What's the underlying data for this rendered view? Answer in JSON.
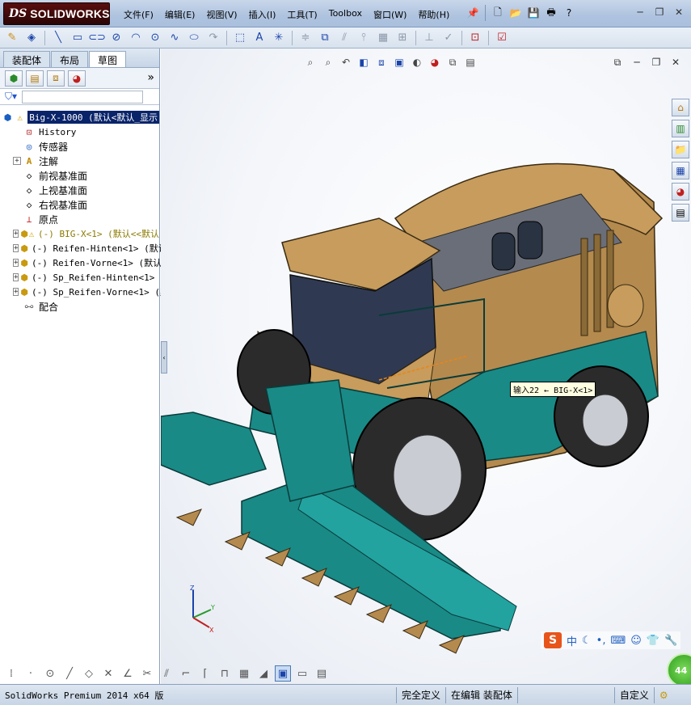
{
  "app": {
    "brand_prefix": "DS",
    "brand": "SOLIDWORKS"
  },
  "menu": [
    {
      "label": "文件(F)"
    },
    {
      "label": "编辑(E)"
    },
    {
      "label": "视图(V)"
    },
    {
      "label": "插入(I)"
    },
    {
      "label": "工具(T)"
    },
    {
      "label": "Toolbox"
    },
    {
      "label": "窗口(W)"
    },
    {
      "label": "帮助(H)"
    }
  ],
  "panel_tabs": [
    {
      "label": "装配体",
      "active": false
    },
    {
      "label": "布局",
      "active": false
    },
    {
      "label": "草图",
      "active": true
    }
  ],
  "tree": {
    "root": {
      "label": "Big-X-1000  (默认<默认_显示"
    },
    "items": [
      {
        "label": "History",
        "icon": "history-icon",
        "expandable": false
      },
      {
        "label": "传感器",
        "icon": "sensor-icon",
        "expandable": false
      },
      {
        "label": "注解",
        "icon": "annotation-icon",
        "expandable": true
      },
      {
        "label": "前视基准面",
        "icon": "plane-icon",
        "expandable": false
      },
      {
        "label": "上视基准面",
        "icon": "plane-icon",
        "expandable": false
      },
      {
        "label": "右视基准面",
        "icon": "plane-icon",
        "expandable": false
      },
      {
        "label": "原点",
        "icon": "origin-icon",
        "expandable": false
      },
      {
        "label": "(-) BIG-X<1> (默认<<默认",
        "icon": "part-warning-icon",
        "expandable": true,
        "warning": true
      },
      {
        "label": "(-) Reifen-Hinten<1> (默认",
        "icon": "subassembly-icon",
        "expandable": true
      },
      {
        "label": "(-) Reifen-Vorne<1> (默认<",
        "icon": "subassembly-icon",
        "expandable": true
      },
      {
        "label": "(-) Sp_Reifen-Hinten<1> (",
        "icon": "subassembly-icon",
        "expandable": true
      },
      {
        "label": "(-) Sp_Reifen-Vorne<1> (默",
        "icon": "subassembly-icon",
        "expandable": true
      },
      {
        "label": "配合",
        "icon": "mates-icon",
        "expandable": false
      }
    ]
  },
  "viewport": {
    "tooltip": "输入22 ← BIG-X<1>",
    "ime": {
      "label": "中"
    },
    "badge": "44"
  },
  "status": {
    "left": "SolidWorks Premium 2014 x64 版",
    "cells": [
      "完全定义",
      "在编辑 装配体",
      "自定义"
    ]
  },
  "colors": {
    "teal": "#1a8a86",
    "tan": "#b48a4e",
    "tree_selection": "#0a246a"
  }
}
